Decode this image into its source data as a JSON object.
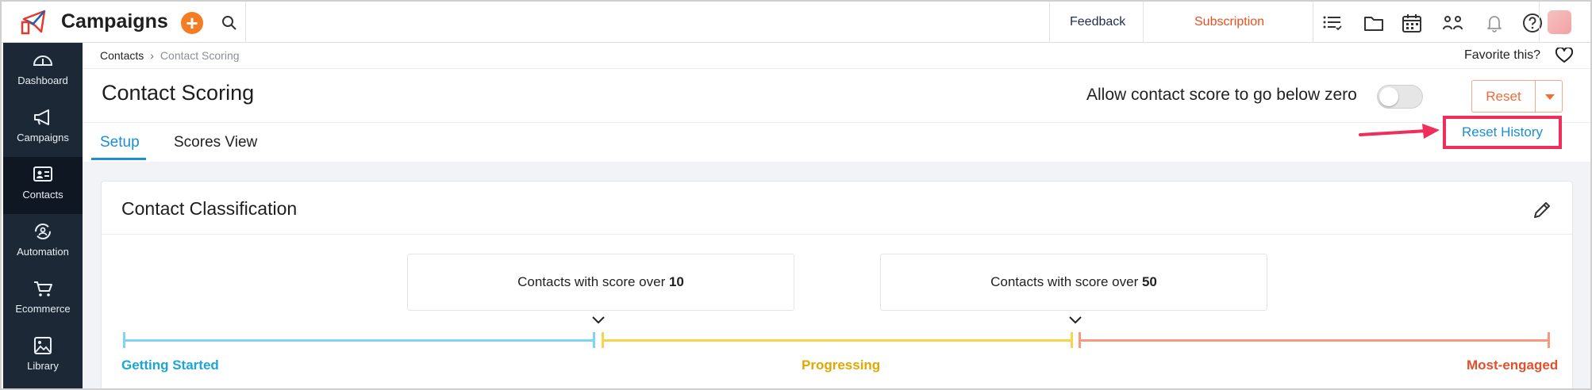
{
  "app": {
    "title": "Campaigns",
    "add_label": "+"
  },
  "topbar": {
    "feedback": "Feedback",
    "subscription": "Subscription",
    "icons": [
      "list-icon",
      "folder-icon",
      "calendar-icon",
      "users-icon",
      "bell-icon",
      "help-icon"
    ]
  },
  "sidebar": {
    "items": [
      {
        "label": "Dashboard",
        "icon": "dashboard-icon"
      },
      {
        "label": "Campaigns",
        "icon": "megaphone-icon"
      },
      {
        "label": "Contacts",
        "icon": "contact-card-icon",
        "active": true
      },
      {
        "label": "Automation",
        "icon": "automation-icon"
      },
      {
        "label": "Ecommerce",
        "icon": "cart-icon"
      },
      {
        "label": "Library",
        "icon": "image-library-icon"
      }
    ]
  },
  "breadcrumb": {
    "parent": "Contacts",
    "separator": "›",
    "current": "Contact Scoring"
  },
  "favorite": {
    "label": "Favorite this?"
  },
  "page": {
    "title": "Contact Scoring",
    "allow_negative_label": "Allow contact score to go below zero",
    "allow_negative_enabled": false,
    "reset_label": "Reset",
    "reset_history_label": "Reset History"
  },
  "tabs": [
    {
      "label": "Setup",
      "active": true
    },
    {
      "label": "Scores View",
      "active": false
    }
  ],
  "classification": {
    "title": "Contact Classification",
    "thresholds": [
      {
        "prefix": "Contacts with score over ",
        "value": "10"
      },
      {
        "prefix": "Contacts with score over ",
        "value": "50"
      }
    ],
    "stages": [
      {
        "label": "Getting Started",
        "color": "#1aa6d8",
        "line_color": "#7fd3f5"
      },
      {
        "label": "Progressing",
        "color": "#e0a800",
        "line_color": "#f7d54a"
      },
      {
        "label": "Most-engaged",
        "color": "#e0502a",
        "line_color": "#f59a7d"
      }
    ]
  },
  "colors": {
    "accent_blue": "#1a8fd6",
    "orange": "#f47c23",
    "highlight_red": "#ef2e5b",
    "sidebar_bg": "#1c2836"
  }
}
